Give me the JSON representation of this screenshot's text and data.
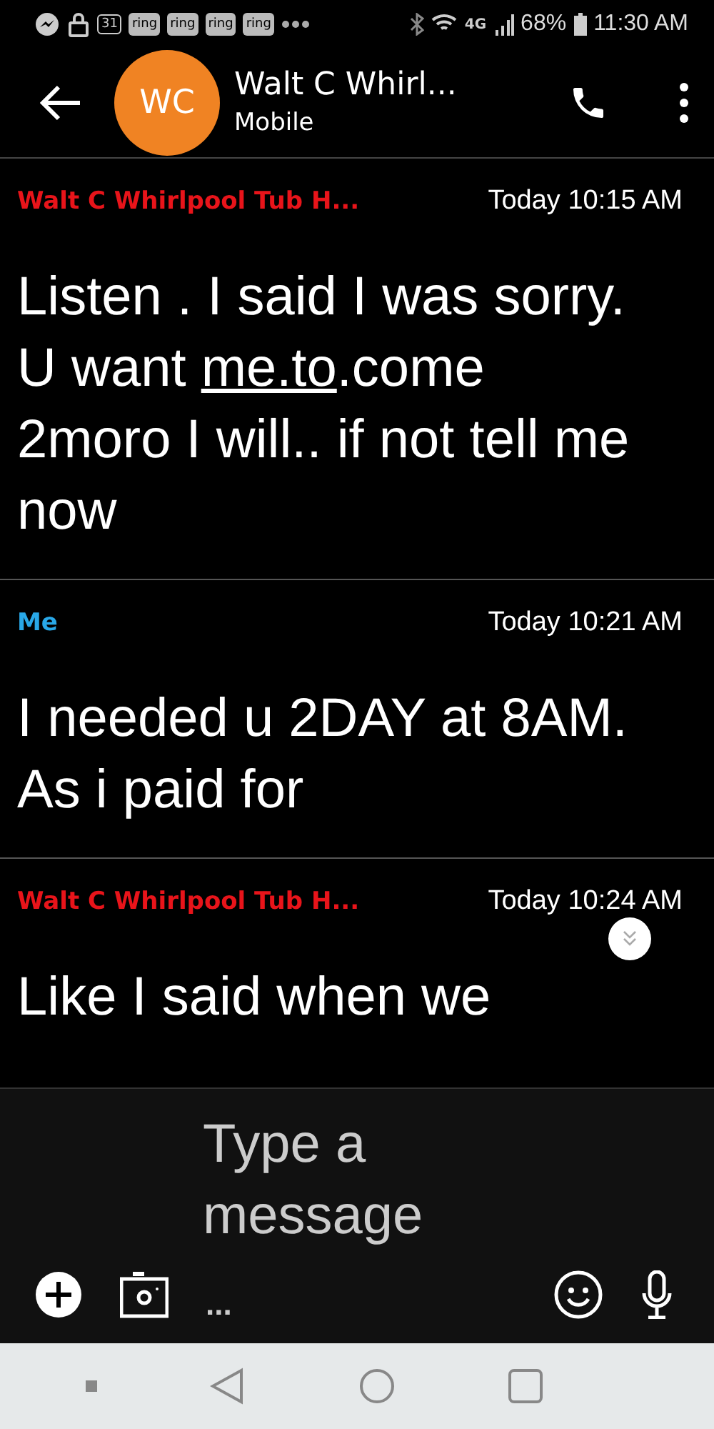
{
  "status_bar": {
    "badges": [
      "31",
      "ring",
      "ring",
      "ring",
      "ring"
    ],
    "network": "4G",
    "battery": "68%",
    "time": "11:30 AM"
  },
  "header": {
    "avatar": "WC",
    "title": "Walt C Whirl...",
    "subtitle": "Mobile"
  },
  "messages": [
    {
      "sender": "Walt C Whirlpool Tub H...",
      "color": "#e8141a",
      "time": "Today 10:15 AM",
      "parts": [
        {
          "kind": "text",
          "text": "Listen . I said I was sorry. U want "
        },
        {
          "kind": "link",
          "text": "me.to"
        },
        {
          "kind": "text",
          "text": ".come 2moro I will.. if not tell me now"
        }
      ]
    },
    {
      "sender": "Me",
      "color": "#29a8e8",
      "time": "Today 10:21 AM",
      "parts": [
        {
          "kind": "text",
          "text": "I needed u 2DAY at 8AM. As i paid for"
        }
      ]
    },
    {
      "sender": "Walt C Whirlpool Tub H...",
      "color": "#e8141a",
      "time": "Today 10:24 AM",
      "parts": [
        {
          "kind": "text",
          "text": "Like I said when we"
        }
      ]
    }
  ],
  "composer": {
    "placeholder": "Type a message",
    "more": "..."
  }
}
